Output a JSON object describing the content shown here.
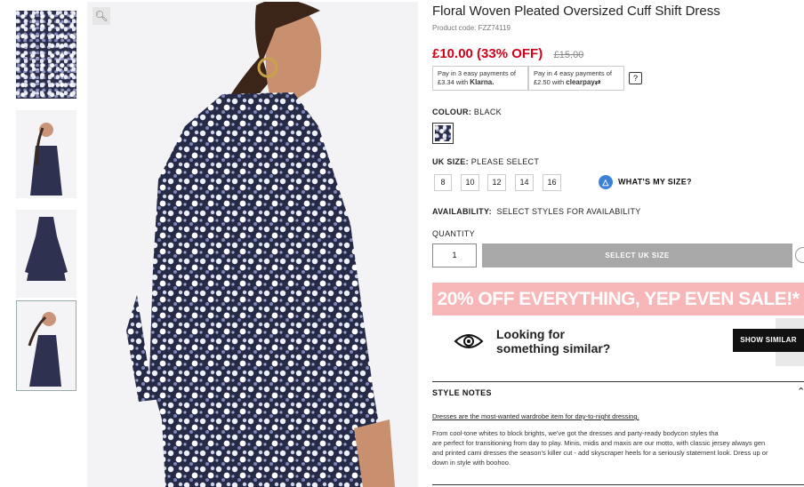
{
  "product": {
    "title": "Floral Woven Pleated Oversized Cuff Shift Dress",
    "code": "Product code: FZZ74119",
    "price": "£10.00 (33% OFF)",
    "was_price": "£15.00"
  },
  "payments": {
    "klarna_line1": "Pay in 3 easy payments of",
    "klarna_line2": "£3.34 with",
    "klarna_brand": "Klarna.",
    "clearpay_line1": "Pay in 4 easy payments of",
    "clearpay_line2": "£2.50 with",
    "clearpay_brand": "clearpay",
    "help": "?"
  },
  "colour": {
    "label": "COLOUR:",
    "value": "BLACK"
  },
  "size": {
    "label": "UK SIZE:",
    "value": "PLEASE SELECT",
    "options": [
      "8",
      "10",
      "12",
      "14",
      "16"
    ],
    "whats_my_size": "WHAT'S MY SIZE?"
  },
  "availability": {
    "label": "AVAILABILITY:",
    "value": "SELECT STYLES FOR AVAILABILITY"
  },
  "quantity": {
    "label": "QUANTITY",
    "value": "1"
  },
  "actions": {
    "select_size": "SELECT UK SIZE"
  },
  "promo": {
    "text": "20% OFF EVERYTHING, YEP EVEN SALE!*"
  },
  "similar": {
    "line1": "Looking for",
    "line2": "something similar?",
    "button": "SHOW SIMILAR"
  },
  "style_notes": {
    "heading": "STYLE NOTES",
    "subheading": "Dresses are the most-wanted wardrobe item for day-to-night dressing.",
    "body": [
      "From cool-tone whites to block brights, we've got the dresses and party-ready bodycon styles tha",
      "are perfect for transitioning from day to play. Minis, midis and maxis are our motto, with classic jersey always gen",
      "and printed cami dresses the season's killer cut - add skyscraper heels for a seriously statement look. Dress up or",
      "down in style with boohoo."
    ]
  },
  "icons": {
    "zoom": "zoom-icon",
    "hanger": "hanger-icon",
    "eye": "eye-icon",
    "heart": "heart-icon",
    "caret": "chevron-up-icon"
  },
  "colors": {
    "sale_red": "#d0021b",
    "promo_pink": "#f7b6b8",
    "button_grey": "#a8a8a8"
  }
}
